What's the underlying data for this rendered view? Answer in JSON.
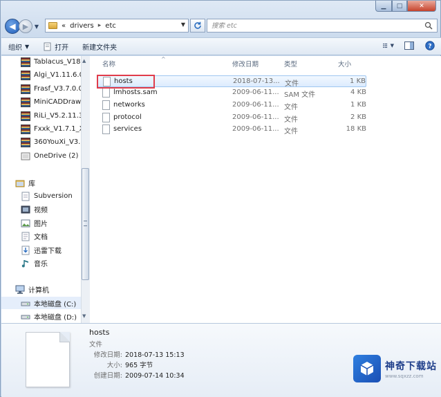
{
  "window": {
    "controls": {
      "minimize": "▁",
      "maximize": "□",
      "close": "✕"
    }
  },
  "nav": {
    "back": "◀",
    "forward": "▶",
    "breadcrumb_prefix": "«",
    "crumbs": [
      "drivers",
      "etc"
    ],
    "crumb_sep": "▸",
    "search_placeholder": "搜索 etc"
  },
  "toolbar": {
    "organize": "组织",
    "open": "打开",
    "new_folder": "新建文件夹"
  },
  "sidebar": {
    "items": [
      {
        "label": "Tablacus_V18",
        "icon": "archive-icon"
      },
      {
        "label": "Algi_V1.11.6.0",
        "icon": "archive-icon"
      },
      {
        "label": "Frasf_V3.7.0.0",
        "icon": "archive-icon"
      },
      {
        "label": "MiniCADDraw",
        "icon": "archive-icon"
      },
      {
        "label": "RiLi_V5.2.11.3",
        "icon": "archive-icon"
      },
      {
        "label": "Fxxk_V1.7.1_X",
        "icon": "archive-icon"
      },
      {
        "label": "360YouXi_V3.",
        "icon": "archive-icon"
      },
      {
        "label": "OneDrive (2)",
        "icon": "onedrive-icon"
      }
    ],
    "library": {
      "label": "库",
      "items": [
        {
          "label": "Subversion",
          "icon": "subversion-icon"
        },
        {
          "label": "视频",
          "icon": "video-icon"
        },
        {
          "label": "图片",
          "icon": "picture-icon"
        },
        {
          "label": "文档",
          "icon": "document-icon"
        },
        {
          "label": "迅雷下载",
          "icon": "download-icon"
        },
        {
          "label": "音乐",
          "icon": "music-icon"
        }
      ]
    },
    "computer": {
      "label": "计算机",
      "items": [
        {
          "label": "本地磁盘 (C:)",
          "icon": "drive-icon"
        },
        {
          "label": "本地磁盘 (D:)",
          "icon": "drive-icon"
        }
      ]
    }
  },
  "columns": {
    "name": "名称",
    "date": "修改日期",
    "type": "类型",
    "size": "大小"
  },
  "files": [
    {
      "name": "hosts",
      "date": "2018-07-13...",
      "type": "文件",
      "size": "1 KB"
    },
    {
      "name": "lmhosts.sam",
      "date": "2009-06-11...",
      "type": "SAM 文件",
      "size": "4 KB"
    },
    {
      "name": "networks",
      "date": "2009-06-11...",
      "type": "文件",
      "size": "1 KB"
    },
    {
      "name": "protocol",
      "date": "2009-06-11...",
      "type": "文件",
      "size": "2 KB"
    },
    {
      "name": "services",
      "date": "2009-06-11...",
      "type": "文件",
      "size": "18 KB"
    }
  ],
  "details": {
    "name": "hosts",
    "type": "文件",
    "modified_label": "修改日期:",
    "modified_value": "2018-07-13 15:13",
    "size_label": "大小:",
    "size_value": "965 字节",
    "created_label": "创建日期:",
    "created_value": "2009-07-14 10:34"
  },
  "watermark": {
    "title": "神奇下载站",
    "url": "www.sqxzz.com"
  },
  "colors": {
    "highlight_border": "#e03b4a",
    "selection": "#dcebfd",
    "accent": "#1b4fb4"
  }
}
